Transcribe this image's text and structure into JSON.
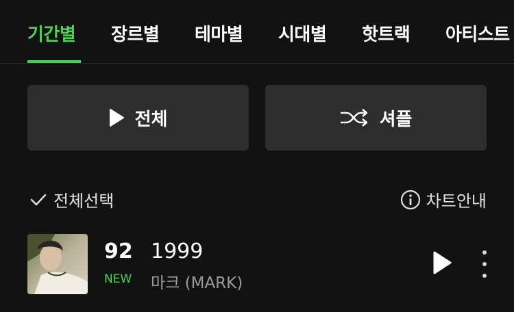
{
  "tabs": [
    {
      "label": "기간별",
      "active": true
    },
    {
      "label": "장르별",
      "active": false
    },
    {
      "label": "테마별",
      "active": false
    },
    {
      "label": "시대별",
      "active": false
    },
    {
      "label": "핫트랙",
      "active": false
    },
    {
      "label": "아티스트",
      "active": false
    }
  ],
  "actions": {
    "play_all_label": "전체",
    "shuffle_label": "셔플"
  },
  "toolbar": {
    "select_all_label": "전체선택",
    "chart_info_label": "차트안내"
  },
  "tracks": [
    {
      "rank": "92",
      "badge": "NEW",
      "title": "1999",
      "artist": "마크 (MARK)"
    }
  ],
  "colors": {
    "accent": "#4fd157",
    "background": "#121212",
    "button_bg": "#2d2d2d",
    "secondary_text": "#9a9a9a"
  },
  "icons": {
    "play_all": "play-icon",
    "shuffle": "shuffle-icon",
    "select_all": "check-icon",
    "chart_info": "info-icon",
    "track_play": "play-icon",
    "track_more": "more-vertical-icon"
  }
}
